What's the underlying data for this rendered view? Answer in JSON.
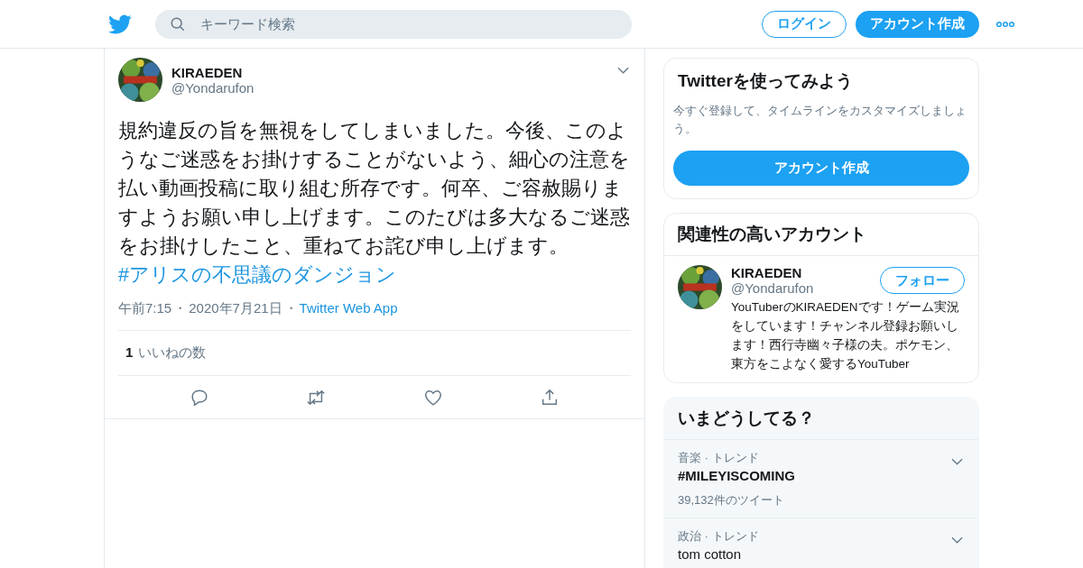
{
  "header": {
    "search": {
      "placeholder": "キーワード検索"
    },
    "login": "ログイン",
    "signup": "アカウント作成"
  },
  "tweet": {
    "name": "KIRAEDEN",
    "handle": "@Yondarufon",
    "text": "規約違反の旨を無視をしてしまいました。今後、このようなご迷惑をお掛けすることがないよう、細心の注意を払い動画投稿に取り組む所存です。何卒、ご容赦賜りますようお願い申し上げます。このたびは多大なるご迷惑をお掛けしたこと、重ねてお詫び申し上げます。",
    "hashtag": "#アリスの不思議のダンジョン",
    "time": "午前7:15",
    "separator": "・",
    "date": "2020年7月21日",
    "source": "Twitter Web App",
    "likes_count": "1",
    "likes_label": "いいねの数"
  },
  "signup_card": {
    "title": "Twitterを使ってみよう",
    "text": "今すぐ登録して、タイムラインをカスタマイズしましょう。",
    "button": "アカウント作成"
  },
  "related": {
    "title": "関連性の高いアカウント",
    "accounts": [
      {
        "name": "KIRAEDEN",
        "handle": "@Yondarufon",
        "follow": "フォロー",
        "bio": "YouTuberのKIRAEDENです！ゲーム実況をしています！チャンネル登録お願いします！西行寺幽々子様の夫。ポケモン、東方をこよなく愛するYouTuber"
      }
    ]
  },
  "trends": {
    "title": "いまどうしてる？",
    "items": [
      {
        "context": "音楽 · トレンド",
        "name": "#MILEYISCOMING",
        "count": "39,132件のツイート"
      },
      {
        "context": "政治 · トレンド",
        "name": "tom cotton"
      }
    ]
  }
}
